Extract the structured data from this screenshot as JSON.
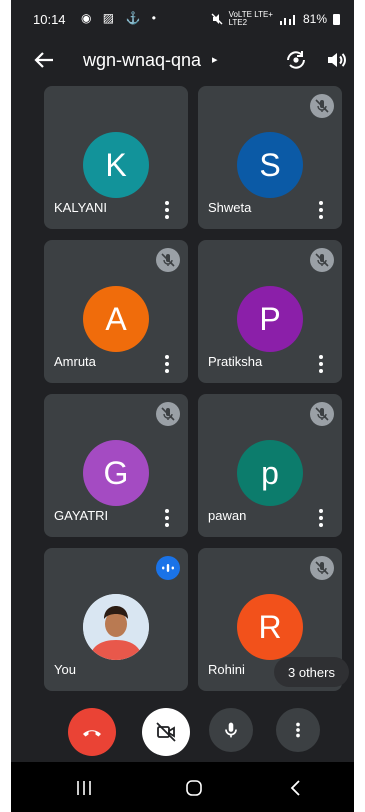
{
  "status_bar": {
    "time": "10:14",
    "left_icons": "◉ ▨ ⚓ •",
    "network_label_top": "VoLTE LTE+",
    "network_label_bottom": "LTE2",
    "battery": "81%"
  },
  "app_bar": {
    "meeting_code": "wgn-wnaq-qna",
    "expand_caret": "▸"
  },
  "participants": [
    {
      "name": "KALYANI",
      "initial": "K",
      "color": "#12939a",
      "muted": false,
      "speaking": false
    },
    {
      "name": "Shweta",
      "initial": "S",
      "color": "#0b5aa6",
      "muted": true,
      "speaking": false
    },
    {
      "name": "Amruta",
      "initial": "A",
      "color": "#f06c0b",
      "muted": true,
      "speaking": false
    },
    {
      "name": "Pratiksha",
      "initial": "P",
      "color": "#8b1fa9",
      "muted": true,
      "speaking": false
    },
    {
      "name": "GAYATRI",
      "initial": "G",
      "color": "#a44bc2",
      "muted": true,
      "speaking": false
    },
    {
      "name": "pawan",
      "initial": "p",
      "color": "#0c7c6c",
      "muted": true,
      "speaking": false
    },
    {
      "name": "You",
      "initial": "",
      "color": "#d9e6f2",
      "muted": false,
      "speaking": true
    },
    {
      "name": "Rohini",
      "initial": "R",
      "color": "#f2511b",
      "muted": true,
      "speaking": false
    }
  ],
  "others_chip": "3 others",
  "colors": {
    "background": "#202124",
    "tile": "#3c4043",
    "end_call": "#ea4335",
    "camera_off_button": "#ffffff",
    "control_button": "#3c4043"
  },
  "icons": {
    "back": "arrow-left",
    "switch_camera": "camera-switch",
    "audio": "speaker",
    "end_call": "phone-hangup",
    "camera_off": "video-off",
    "mic": "microphone",
    "more": "more-vertical",
    "nav_recents": "recents",
    "nav_home": "home",
    "nav_back": "back"
  }
}
